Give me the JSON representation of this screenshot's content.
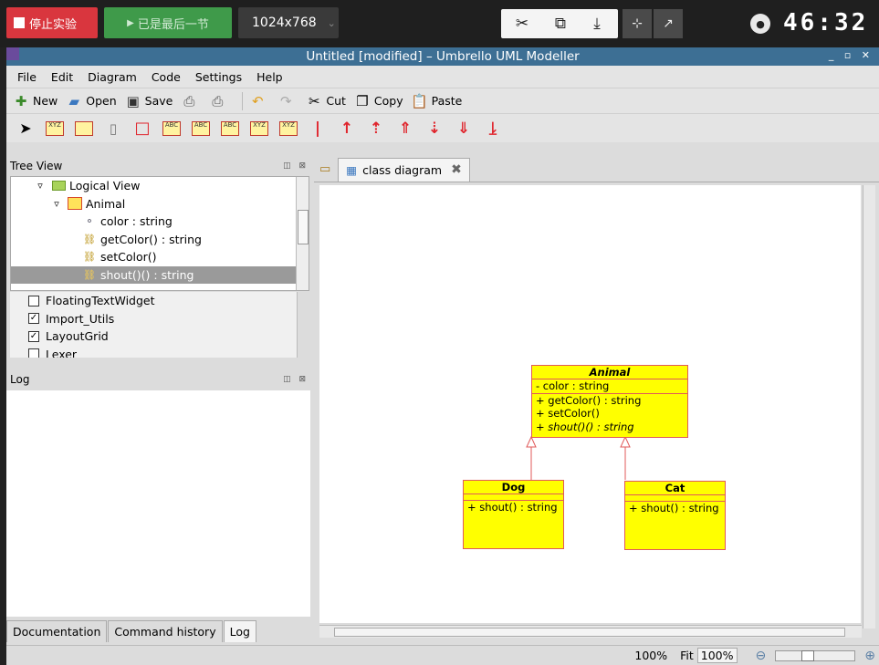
{
  "topbar": {
    "stop_label": "停止实验",
    "last_label": "已是最后一节",
    "resolution": "1024x768",
    "timer": "46:32"
  },
  "window": {
    "title": "Untitled [modified] – Umbrello UML Modeller"
  },
  "menu": [
    "File",
    "Edit",
    "Diagram",
    "Code",
    "Settings",
    "Help"
  ],
  "toolbar": {
    "new": "New",
    "open": "Open",
    "save": "Save",
    "cut": "Cut",
    "copy": "Copy",
    "paste": "Paste"
  },
  "tree_view": {
    "title": "Tree View",
    "items": [
      {
        "label": "Logical View",
        "kind": "folder"
      },
      {
        "label": "Animal",
        "kind": "class"
      },
      {
        "label": "color : string",
        "kind": "attribute"
      },
      {
        "label": "getColor() : string",
        "kind": "operation"
      },
      {
        "label": "setColor()",
        "kind": "operation"
      },
      {
        "label": "shout()() : string",
        "kind": "operation",
        "selected": true
      }
    ]
  },
  "checklist": {
    "items": [
      {
        "label": "FloatingTextWidget",
        "checked": false
      },
      {
        "label": "Import_Utils",
        "checked": true
      },
      {
        "label": "LayoutGrid",
        "checked": true
      },
      {
        "label": "Lexer",
        "checked": false
      }
    ]
  },
  "log": {
    "title": "Log"
  },
  "bottom_tabs": [
    "Documentation",
    "Command history",
    "Log"
  ],
  "diagram": {
    "tab_label": "class diagram",
    "classes": {
      "animal": {
        "name": "Animal",
        "attrs": [
          "- color : string"
        ],
        "ops": [
          "+ getColor() : string",
          "+ setColor()",
          "+ shout()() : string"
        ]
      },
      "dog": {
        "name": "Dog",
        "ops": [
          "+ shout() : string"
        ]
      },
      "cat": {
        "name": "Cat",
        "ops": [
          "+ shout() : string"
        ]
      }
    }
  },
  "status": {
    "zoom": "100%",
    "fit": "Fit",
    "zoom_btn": "100%"
  },
  "colors": {
    "class_fill": "#ffff00",
    "class_border": "#e05a5a",
    "titlebar": "#3d6f94"
  }
}
